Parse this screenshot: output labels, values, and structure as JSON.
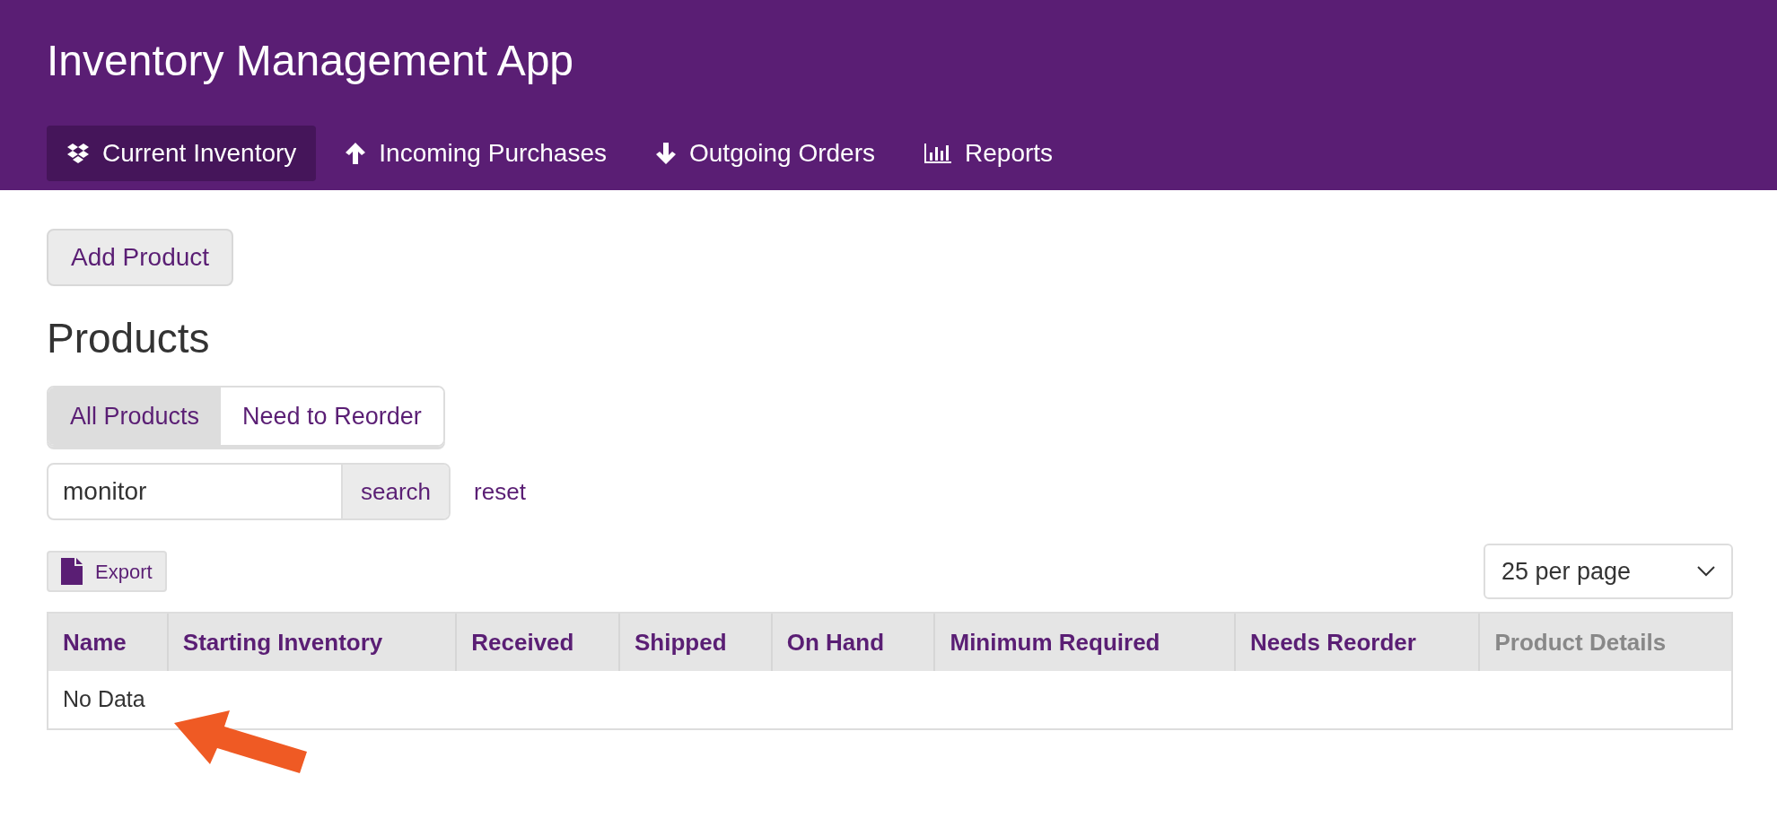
{
  "app_title": "Inventory Management App",
  "nav": [
    {
      "label": "Current Inventory",
      "selected": true
    },
    {
      "label": "Incoming Purchases",
      "selected": false
    },
    {
      "label": "Outgoing Orders",
      "selected": false
    },
    {
      "label": "Reports",
      "selected": false
    }
  ],
  "add_button": "Add Product",
  "heading": "Products",
  "filter_tabs": [
    {
      "label": "All Products",
      "selected": true
    },
    {
      "label": "Need to Reorder",
      "selected": false
    }
  ],
  "search": {
    "value": "monitor",
    "button": "search",
    "reset": "reset"
  },
  "export_button": "Export",
  "page_size": "25 per page",
  "table": {
    "columns": [
      {
        "label": "Name",
        "sortable": true
      },
      {
        "label": "Starting Inventory",
        "sortable": true
      },
      {
        "label": "Received",
        "sortable": true
      },
      {
        "label": "Shipped",
        "sortable": true
      },
      {
        "label": "On Hand",
        "sortable": true
      },
      {
        "label": "Minimum Required",
        "sortable": true
      },
      {
        "label": "Needs Reorder",
        "sortable": true
      },
      {
        "label": "Product Details",
        "sortable": false
      }
    ],
    "empty_text": "No Data"
  }
}
